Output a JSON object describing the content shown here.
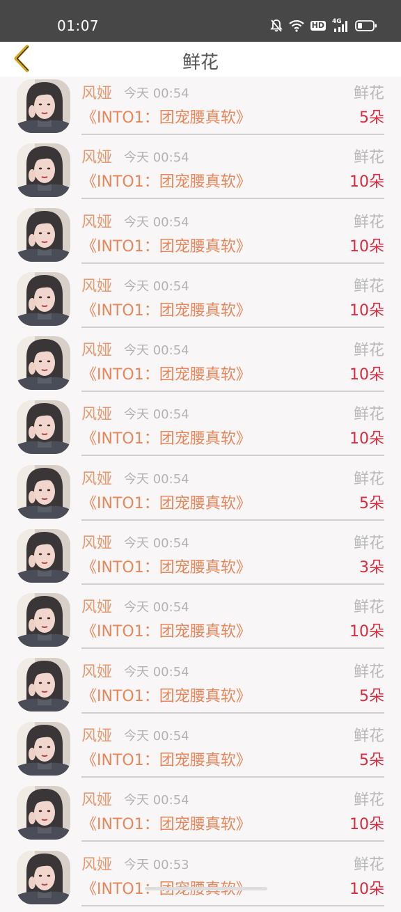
{
  "status_bar": {
    "time": "01:07",
    "icons": [
      "mute-bell-icon",
      "wifi-icon",
      "hd-icon",
      "signal-4g-icon",
      "battery-icon"
    ],
    "hd_label": "HD",
    "network_label": "4G"
  },
  "nav": {
    "back_icon": "chevron-left-icon",
    "back_icon_color": "#dba518",
    "title": "鲜花"
  },
  "colors": {
    "name": "#e6996e",
    "time": "#b3b3b3",
    "gift_type": "#b8b8b8",
    "work_title": "#e8865a",
    "gift_count": "#d62c40"
  },
  "rows": [
    {
      "name": "风娅",
      "time": "今天 00:54",
      "gift": "鲜花",
      "title": "《INTO1：团宠腰真软》",
      "count": "5朵"
    },
    {
      "name": "风娅",
      "time": "今天 00:54",
      "gift": "鲜花",
      "title": "《INTO1：团宠腰真软》",
      "count": "10朵"
    },
    {
      "name": "风娅",
      "time": "今天 00:54",
      "gift": "鲜花",
      "title": "《INTO1：团宠腰真软》",
      "count": "10朵"
    },
    {
      "name": "风娅",
      "time": "今天 00:54",
      "gift": "鲜花",
      "title": "《INTO1：团宠腰真软》",
      "count": "10朵"
    },
    {
      "name": "风娅",
      "time": "今天 00:54",
      "gift": "鲜花",
      "title": "《INTO1：团宠腰真软》",
      "count": "10朵"
    },
    {
      "name": "风娅",
      "time": "今天 00:54",
      "gift": "鲜花",
      "title": "《INTO1：团宠腰真软》",
      "count": "10朵"
    },
    {
      "name": "风娅",
      "time": "今天 00:54",
      "gift": "鲜花",
      "title": "《INTO1：团宠腰真软》",
      "count": "5朵"
    },
    {
      "name": "风娅",
      "time": "今天 00:54",
      "gift": "鲜花",
      "title": "《INTO1：团宠腰真软》",
      "count": "3朵"
    },
    {
      "name": "风娅",
      "time": "今天 00:54",
      "gift": "鲜花",
      "title": "《INTO1：团宠腰真软》",
      "count": "10朵"
    },
    {
      "name": "风娅",
      "time": "今天 00:54",
      "gift": "鲜花",
      "title": "《INTO1：团宠腰真软》",
      "count": "5朵"
    },
    {
      "name": "风娅",
      "time": "今天 00:54",
      "gift": "鲜花",
      "title": "《INTO1：团宠腰真软》",
      "count": "5朵"
    },
    {
      "name": "风娅",
      "time": "今天 00:54",
      "gift": "鲜花",
      "title": "《INTO1：团宠腰真软》",
      "count": "10朵"
    },
    {
      "name": "风娅",
      "time": "今天 00:53",
      "gift": "鲜花",
      "title": "《INTO1：团宠腰真软》",
      "count": "10朵"
    }
  ]
}
